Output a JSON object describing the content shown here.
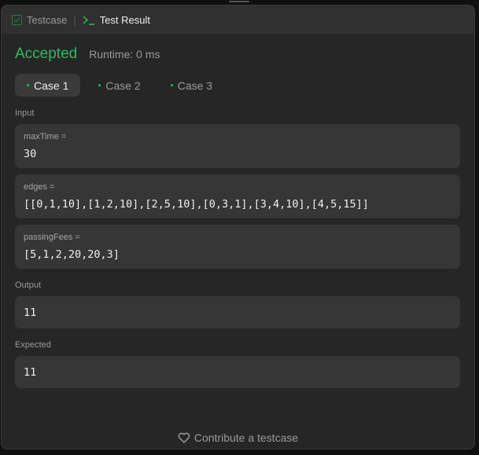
{
  "tabs": {
    "testcase": "Testcase",
    "result": "Test Result"
  },
  "status": {
    "verdict": "Accepted",
    "runtime": "Runtime: 0 ms"
  },
  "cases": [
    "Case 1",
    "Case 2",
    "Case 3"
  ],
  "labels": {
    "input": "Input",
    "output": "Output",
    "expected": "Expected"
  },
  "inputs": [
    {
      "name": "maxTime =",
      "value": "30"
    },
    {
      "name": "edges =",
      "value": "[[0,1,10],[1,2,10],[2,5,10],[0,3,1],[3,4,10],[4,5,15]]"
    },
    {
      "name": "passingFees =",
      "value": "[5,1,2,20,20,3]"
    }
  ],
  "output": "11",
  "expected": "11",
  "footer": "Contribute a testcase",
  "colors": {
    "accent": "#2cbb5d",
    "panel": "#262626"
  }
}
